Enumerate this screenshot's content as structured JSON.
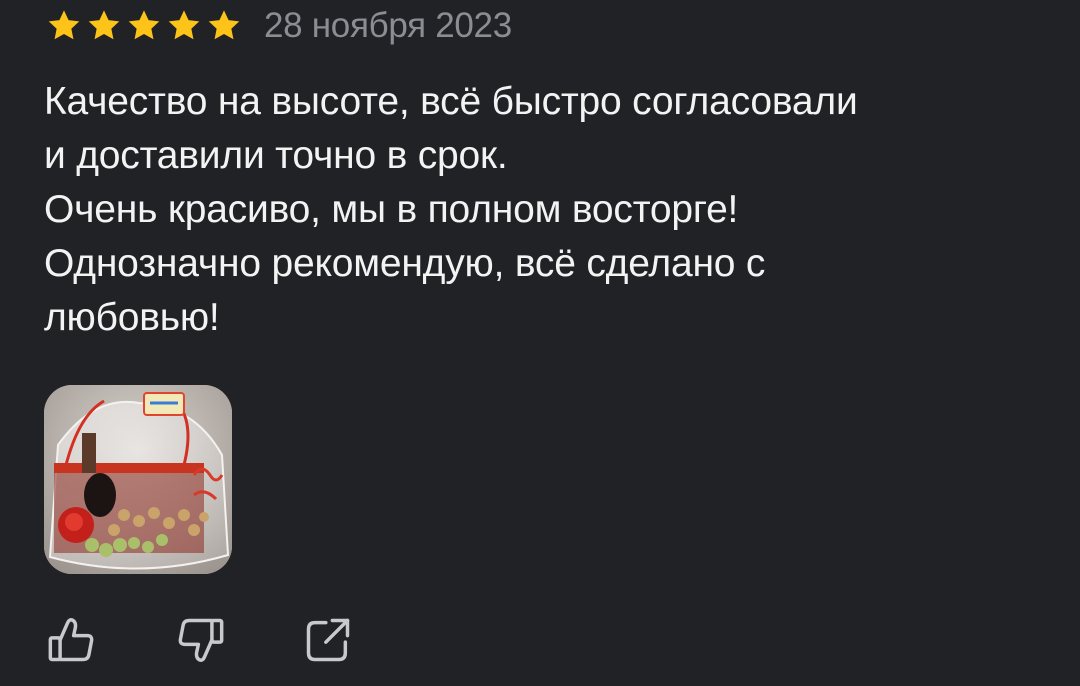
{
  "review": {
    "rating": 5,
    "rating_max": 5,
    "date": "28 ноября 2023",
    "text_lines": [
      "Качество на высоте, всё быстро согласовали",
      "и доставили точно в срок.",
      "Очень красиво, мы в полном восторге!",
      "Однозначно рекомендую, всё сделано с",
      "любовью!"
    ],
    "photo": {
      "icon": "photo-thumbnail-gift-basket"
    }
  },
  "actions": {
    "like_icon": "thumbs-up-icon",
    "dislike_icon": "thumbs-down-icon",
    "share_icon": "share-external-icon"
  },
  "colors": {
    "background": "#212226",
    "star": "#fcc419",
    "date": "#8c8d92",
    "text": "#f3f3f3",
    "icon": "#c9c9cc"
  }
}
